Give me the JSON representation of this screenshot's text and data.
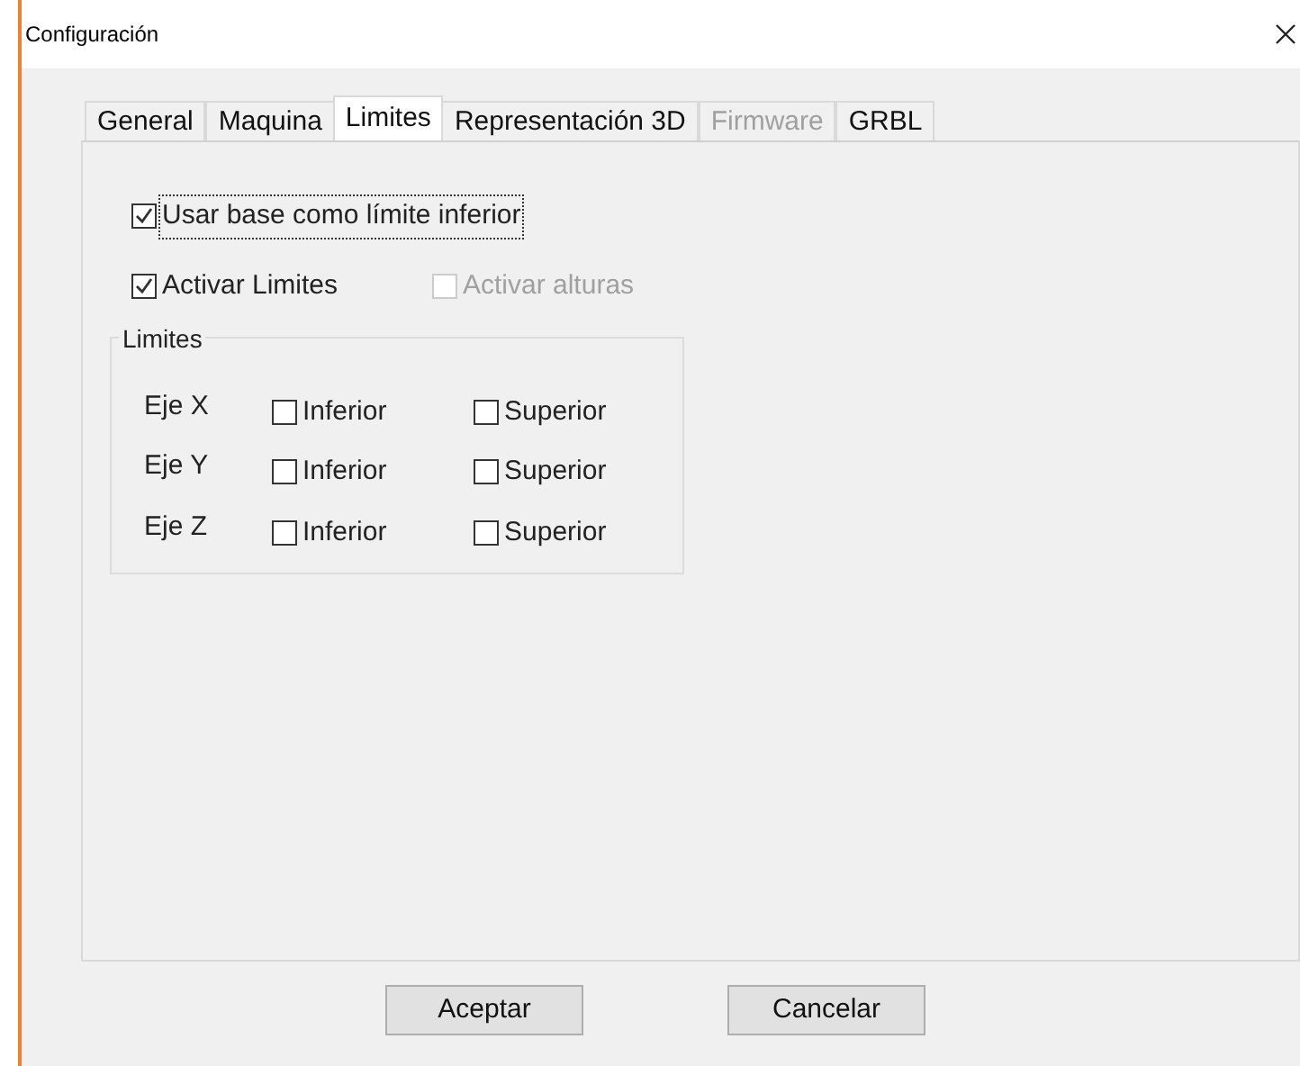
{
  "window": {
    "title": "Configuración"
  },
  "tabs": [
    {
      "label": "General",
      "selected": false,
      "disabled": false
    },
    {
      "label": "Maquina",
      "selected": false,
      "disabled": false
    },
    {
      "label": "Limites",
      "selected": true,
      "disabled": false
    },
    {
      "label": "Representación 3D",
      "selected": false,
      "disabled": false
    },
    {
      "label": "Firmware",
      "selected": false,
      "disabled": true
    },
    {
      "label": "GRBL",
      "selected": false,
      "disabled": false
    }
  ],
  "options": [
    {
      "label": "Usar base como límite inferior",
      "checked": true,
      "disabled": false,
      "focused": true
    },
    {
      "label": "Activar Limites",
      "checked": true,
      "disabled": false,
      "focused": false
    },
    {
      "label": "Activar alturas",
      "checked": false,
      "disabled": true,
      "focused": false
    }
  ],
  "limits_group": {
    "title": "Limites",
    "rows": [
      {
        "axis": "Eje X",
        "lower": {
          "label": "Inferior",
          "checked": false
        },
        "upper": {
          "label": "Superior",
          "checked": false
        }
      },
      {
        "axis": "Eje Y",
        "lower": {
          "label": "Inferior",
          "checked": false
        },
        "upper": {
          "label": "Superior",
          "checked": false
        }
      },
      {
        "axis": "Eje Z",
        "lower": {
          "label": "Inferior",
          "checked": false
        },
        "upper": {
          "label": "Superior",
          "checked": false
        }
      }
    ]
  },
  "buttons": [
    "Aceptar",
    "Cancelar"
  ]
}
